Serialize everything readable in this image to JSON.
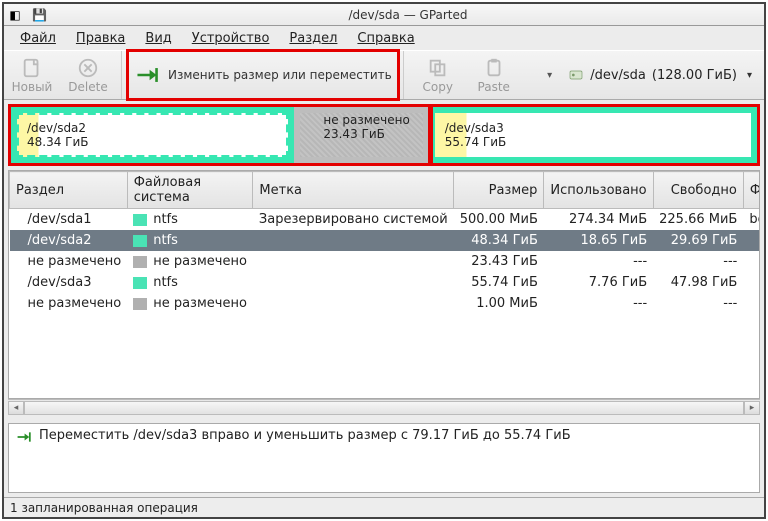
{
  "window": {
    "title": "/dev/sda — GParted"
  },
  "menu": {
    "file": "Файл",
    "edit": "Правка",
    "view": "Вид",
    "device": "Устройство",
    "partition": "Раздел",
    "help": "Справка"
  },
  "toolbar": {
    "new": "Новый",
    "delete": "Delete",
    "resize": "Изменить размер или переместить",
    "copy": "Copy",
    "paste": "Paste"
  },
  "device_picker": {
    "path": "/dev/sda",
    "size": "(128.00 ГиБ)"
  },
  "diskmap": {
    "sda2_path": "/dev/sda2",
    "sda2_size": "48.34 ГиБ",
    "unalloc_label": "не размечено",
    "unalloc_size": "23.43 ГиБ",
    "sda3_path": "/dev/sda3",
    "sda3_size": "55.74 ГиБ"
  },
  "table": {
    "headers": {
      "partition": "Раздел",
      "fs": "Файловая система",
      "label": "Метка",
      "size": "Размер",
      "used": "Использовано",
      "free": "Свободно",
      "flags": "Флаги"
    },
    "rows": [
      {
        "part": "/dev/sda1",
        "fs": "ntfs",
        "fs_class": "sw-ntfs",
        "label": "Зарезервировано системой",
        "size": "500.00 МиБ",
        "used": "274.34 МиБ",
        "free": "225.66 МиБ",
        "flags": "boot"
      },
      {
        "part": "/dev/sda2",
        "fs": "ntfs",
        "fs_class": "sw-ntfs",
        "label": "",
        "size": "48.34 ГиБ",
        "used": "18.65 ГиБ",
        "free": "29.69 ГиБ",
        "flags": "",
        "selected": true
      },
      {
        "part": "не размечено",
        "fs": "не размечено",
        "fs_class": "sw-unalloc",
        "label": "",
        "size": "23.43 ГиБ",
        "used": "---",
        "free": "---",
        "flags": ""
      },
      {
        "part": "/dev/sda3",
        "fs": "ntfs",
        "fs_class": "sw-ntfs",
        "label": "",
        "size": "55.74 ГиБ",
        "used": "7.76 ГиБ",
        "free": "47.98 ГиБ",
        "flags": ""
      },
      {
        "part": "не размечено",
        "fs": "не размечено",
        "fs_class": "sw-unalloc",
        "label": "",
        "size": "1.00 МиБ",
        "used": "---",
        "free": "---",
        "flags": ""
      }
    ]
  },
  "pending": {
    "op": "Переместить /dev/sda3 вправо и уменьшить размер с 79.17 ГиБ до 55.74 ГиБ"
  },
  "status": {
    "text": "1 запланированная операция"
  }
}
